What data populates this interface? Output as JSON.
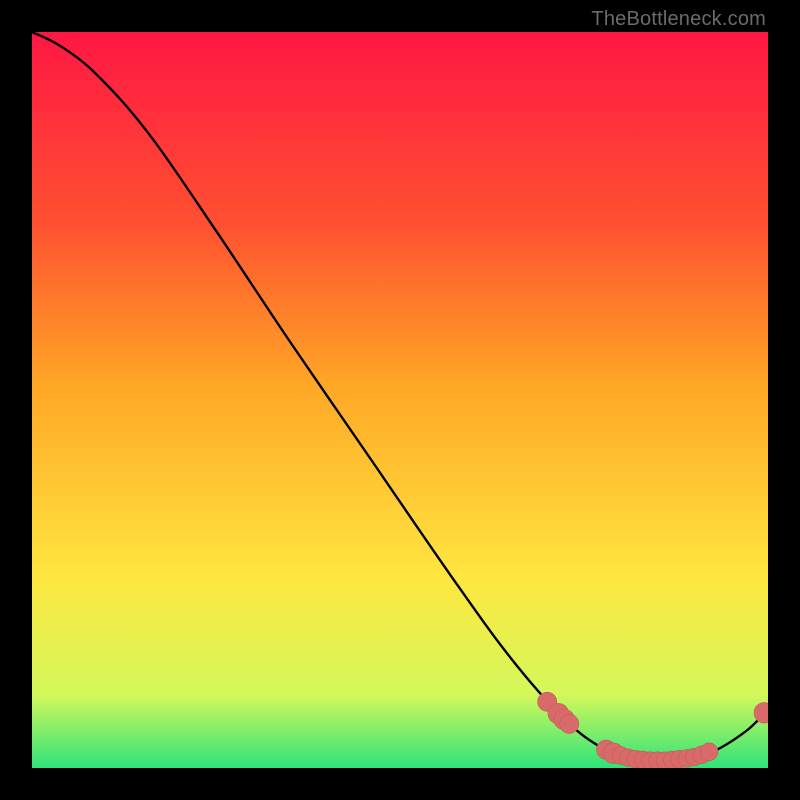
{
  "attribution": "TheBottleneck.com",
  "colors": {
    "bg": "#000000",
    "gradient_top": "#ff1744",
    "gradient_upper": "#ff5030",
    "gradient_mid": "#ffa726",
    "gradient_lower": "#ffe640",
    "gradient_yellowgreen": "#d4f85a",
    "gradient_green": "#2ee37a",
    "curve": "#000000",
    "marker_fill": "#d96a6a",
    "marker_stroke": "#c45a5a",
    "attribution_text": "#6b6b6b"
  },
  "chart_data": {
    "type": "line",
    "title": "",
    "xlabel": "",
    "ylabel": "",
    "xlim": [
      0,
      100
    ],
    "ylim": [
      0,
      100
    ],
    "curve": [
      {
        "x": 0,
        "y": 100
      },
      {
        "x": 4,
        "y": 98
      },
      {
        "x": 9,
        "y": 94
      },
      {
        "x": 16,
        "y": 86
      },
      {
        "x": 25,
        "y": 73
      },
      {
        "x": 35,
        "y": 58
      },
      {
        "x": 46,
        "y": 42
      },
      {
        "x": 57,
        "y": 26
      },
      {
        "x": 65,
        "y": 15
      },
      {
        "x": 72,
        "y": 7
      },
      {
        "x": 77,
        "y": 3
      },
      {
        "x": 82,
        "y": 1
      },
      {
        "x": 87,
        "y": 1
      },
      {
        "x": 92,
        "y": 2
      },
      {
        "x": 97,
        "y": 5
      },
      {
        "x": 100,
        "y": 8
      }
    ],
    "markers": [
      {
        "x": 70.0,
        "y": 9.0,
        "r": 1.3
      },
      {
        "x": 71.5,
        "y": 7.4,
        "r": 1.4
      },
      {
        "x": 72.3,
        "y": 6.6,
        "r": 1.4
      },
      {
        "x": 73.0,
        "y": 6.0,
        "r": 1.3
      },
      {
        "x": 78.0,
        "y": 2.5,
        "r": 1.3
      },
      {
        "x": 79.0,
        "y": 2.0,
        "r": 1.4
      },
      {
        "x": 80.0,
        "y": 1.7,
        "r": 1.2
      },
      {
        "x": 81.0,
        "y": 1.4,
        "r": 1.2
      },
      {
        "x": 82.0,
        "y": 1.2,
        "r": 1.2
      },
      {
        "x": 83.0,
        "y": 1.1,
        "r": 1.2
      },
      {
        "x": 84.0,
        "y": 1.0,
        "r": 1.2
      },
      {
        "x": 85.0,
        "y": 1.0,
        "r": 1.2
      },
      {
        "x": 86.0,
        "y": 1.0,
        "r": 1.2
      },
      {
        "x": 87.0,
        "y": 1.1,
        "r": 1.2
      },
      {
        "x": 88.0,
        "y": 1.2,
        "r": 1.2
      },
      {
        "x": 89.0,
        "y": 1.3,
        "r": 1.2
      },
      {
        "x": 90.0,
        "y": 1.5,
        "r": 1.2
      },
      {
        "x": 91.0,
        "y": 1.8,
        "r": 1.2
      },
      {
        "x": 92.0,
        "y": 2.2,
        "r": 1.2
      },
      {
        "x": 99.5,
        "y": 7.5,
        "r": 1.4
      }
    ]
  }
}
